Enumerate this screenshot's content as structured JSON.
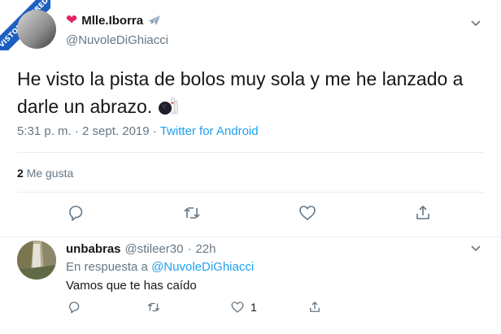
{
  "watermark": {
    "text": "VISTOENLASREDES"
  },
  "tweet": {
    "author_name": "Mlle.Iborra",
    "author_handle": "@NuvoleDiGhiacci",
    "text": "He visto la pista de bolos muy sola y me he lanzado a darle un abrazo.",
    "time": "5:31 p. m.",
    "date_separator": "·",
    "date": "2 sept. 2019",
    "source": "Twitter for Android",
    "likes_count": "2",
    "likes_label": "Me gusta",
    "icons": [
      "heart-emoji",
      "airplane-emoji",
      "bowling-emoji",
      "chevron-down-icon",
      "reply-icon",
      "retweet-icon",
      "like-icon",
      "share-icon"
    ]
  },
  "reply": {
    "author_name": "unbabras",
    "author_handle": "@stileer30",
    "dot": "·",
    "time": "22h",
    "in_reply_prefix": "En respuesta a",
    "in_reply_mention": "@NuvoleDiGhiacci",
    "text": "Vamos que te has caído",
    "like_count": "1"
  },
  "colors": {
    "accent": "#1da1f2",
    "secondary_text": "#657786",
    "heart": "#e0245e",
    "divider": "#e6ecf0"
  }
}
